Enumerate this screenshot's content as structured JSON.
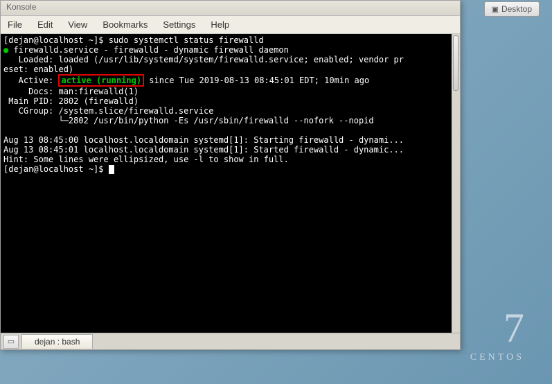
{
  "desktop": {
    "button_label": "Desktop",
    "logo_number": "7",
    "logo_text": "CENTOS"
  },
  "window": {
    "title_fragment": "Konsole"
  },
  "menubar": {
    "items": [
      "File",
      "Edit",
      "View",
      "Bookmarks",
      "Settings",
      "Help"
    ]
  },
  "terminal": {
    "prompt1_user": "[dejan@localhost ~]$ ",
    "prompt1_cmd": "sudo systemctl status firewalld",
    "line_service": " firewalld.service - firewalld - dynamic firewall daemon",
    "line_loaded1": "   Loaded: loaded (/usr/lib/systemd/system/firewalld.service; enabled; vendor pr",
    "line_loaded2": "eset: enabled)",
    "line_active_prefix": "   Active: ",
    "line_active_status": "active (running)",
    "line_active_suffix": " since Tue 2019-08-13 08:45:01 EDT; 10min ago",
    "line_docs": "     Docs: man:firewalld(1)",
    "line_pid": " Main PID: 2802 (firewalld)",
    "line_cgroup1": "   CGroup: /system.slice/firewalld.service",
    "line_cgroup2": "           └─2802 /usr/bin/python -Es /usr/sbin/firewalld --nofork --nopid",
    "line_blank": "",
    "line_log1": "Aug 13 08:45:00 localhost.localdomain systemd[1]: Starting firewalld - dynami...",
    "line_log2": "Aug 13 08:45:01 localhost.localdomain systemd[1]: Started firewalld - dynamic...",
    "line_hint": "Hint: Some lines were ellipsized, use -l to show in full.",
    "prompt2": "[dejan@localhost ~]$ "
  },
  "tab": {
    "label": "dejan : bash"
  }
}
